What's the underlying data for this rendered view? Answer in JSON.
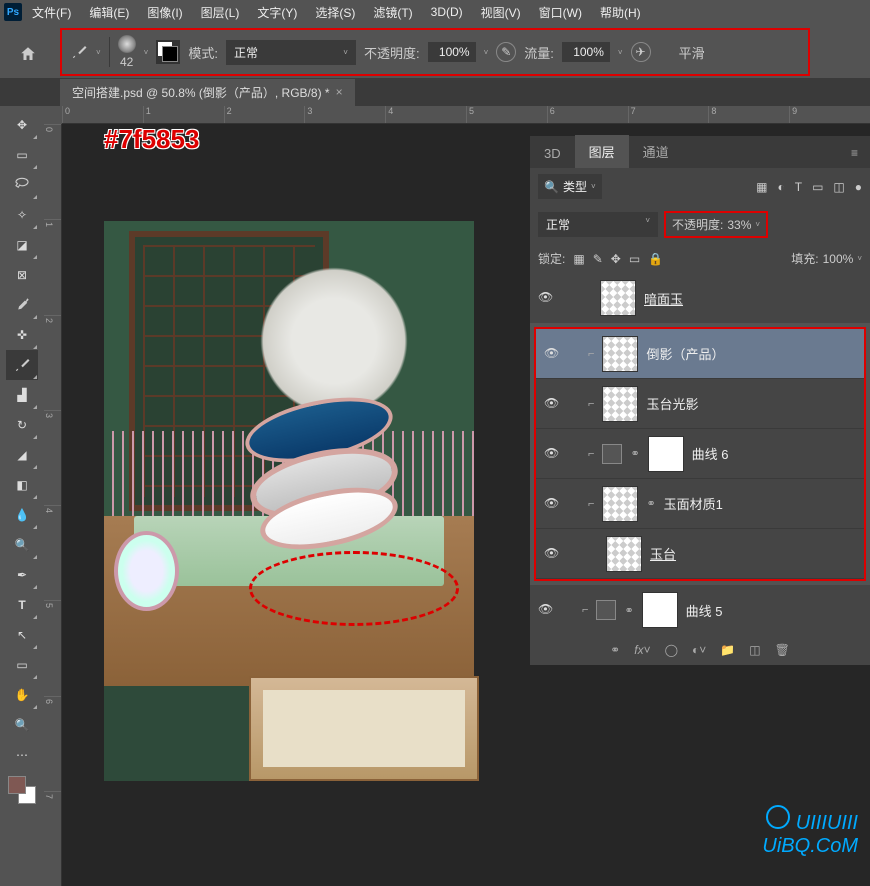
{
  "menu": {
    "file": "文件(F)",
    "edit": "编辑(E)",
    "image": "图像(I)",
    "layer": "图层(L)",
    "text": "文字(Y)",
    "select": "选择(S)",
    "filter": "滤镜(T)",
    "3d": "3D(D)",
    "view": "视图(V)",
    "window": "窗口(W)",
    "help": "帮助(H)"
  },
  "options": {
    "brush_size": "42",
    "mode_label": "模式:",
    "mode_value": "正常",
    "opacity_label": "不透明度:",
    "opacity_value": "100%",
    "flow_label": "流量:",
    "flow_value": "100%",
    "smooth_label": "平滑"
  },
  "tab": {
    "title": "空间搭建.psd @ 50.8% (倒影（产品）, RGB/8) *"
  },
  "annotation": {
    "color": "#7f5853"
  },
  "panel": {
    "tab_3d": "3D",
    "tab_layers": "图层",
    "tab_channels": "通道"
  },
  "filter": {
    "type_label": "类型"
  },
  "blend": {
    "mode": "正常",
    "opacity_label": "不透明度:",
    "opacity_value": "33%"
  },
  "lock": {
    "label": "锁定:",
    "fill_label": "填充:",
    "fill_value": "100%"
  },
  "layers": [
    {
      "name": "暗面玉",
      "clip": false,
      "thumb": "checker",
      "sel": false,
      "outside": true
    },
    {
      "name": "倒影（产品）",
      "clip": true,
      "thumb": "checker",
      "sel": true
    },
    {
      "name": "玉台光影",
      "clip": true,
      "thumb": "checker",
      "sel": false
    },
    {
      "name": "曲线 6",
      "clip": true,
      "thumb": "adj",
      "sel": false,
      "mask": true
    },
    {
      "name": "玉面材质1",
      "clip": true,
      "thumb": "checker",
      "sel": false,
      "link": true
    },
    {
      "name": "玉台",
      "clip": false,
      "thumb": "checker",
      "sel": false
    },
    {
      "name": "曲线 5",
      "clip": true,
      "thumb": "adj",
      "sel": false,
      "mask": true,
      "outside": true
    }
  ],
  "watermark": {
    "line1": "UIIIUIII",
    "line2": "UiBQ.CoM"
  }
}
